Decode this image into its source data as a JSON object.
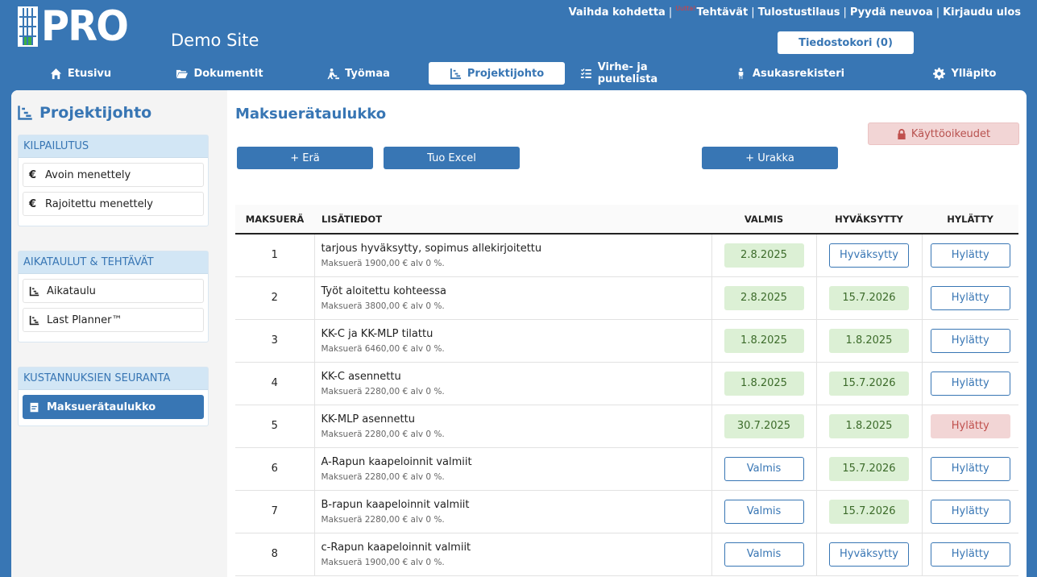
{
  "header": {
    "logo_text": "PRO",
    "site_title": "Demo Site",
    "top_links": [
      {
        "label": "Vaihda kohdetta"
      },
      {
        "label": "Tehtävät",
        "badge": "Uutta!"
      },
      {
        "label": "Tulostustilaus"
      },
      {
        "label": "Pyydä neuvoa"
      },
      {
        "label": "Kirjaudu ulos"
      }
    ],
    "cart_label": "Tiedostokori (0)"
  },
  "nav": {
    "items": [
      {
        "label": "Etusivu",
        "icon": "home-icon"
      },
      {
        "label": "Dokumentit",
        "icon": "folder-icon"
      },
      {
        "label": "Työmaa",
        "icon": "worker-icon"
      },
      {
        "label": "Projektijohto",
        "icon": "chart-icon",
        "active": true
      },
      {
        "label": "Virhe- ja puutelista",
        "icon": "checklist-icon"
      },
      {
        "label": "Asukasrekisteri",
        "icon": "person-icon"
      },
      {
        "label": "Ylläpito",
        "icon": "gear-icon"
      }
    ]
  },
  "sidebar": {
    "title": "Projektijohto",
    "sections": [
      {
        "title": "KILPAILUTUS",
        "items": [
          {
            "label": "Avoin menettely",
            "icon": "euro"
          },
          {
            "label": "Rajoitettu menettely",
            "icon": "euro"
          }
        ]
      },
      {
        "title": "AIKATAULUT & TEHTÄVÄT",
        "items": [
          {
            "label": "Aikataulu",
            "icon": "chart"
          },
          {
            "label": "Last Planner™",
            "icon": "chart"
          }
        ]
      },
      {
        "title": "KUSTANNUKSIEN SEURANTA",
        "items": [
          {
            "label": "Maksuerätaulukko",
            "icon": "doc",
            "active": true
          }
        ]
      }
    ]
  },
  "main": {
    "title": "Maksuerätaulukko",
    "permissions_label": "Käyttöoikeudet",
    "buttons": {
      "add_batch": "+ Erä",
      "import_excel": "Tuo Excel",
      "add_contract": "+ Urakka"
    },
    "table": {
      "headers": [
        "MAKSUERÄ",
        "LISÄTIEDOT",
        "VALMIS",
        "HYVÄKSYTTY",
        "HYLÄTTY"
      ],
      "rows": [
        {
          "num": "1",
          "desc": "tarjous hyväksytty, sopimus allekirjoitettu",
          "sub": "Maksuerä 1900,00 € alv 0 %.",
          "valmis": "2.8.2025",
          "valmis_state": "ok",
          "hyvaksytty": "Hyväksytty",
          "hyvaksytty_state": "outline",
          "hylatty": "Hylätty",
          "hylatty_state": "outline"
        },
        {
          "num": "2",
          "desc": "Työt aloitettu kohteessa",
          "sub": "Maksuerä 3800,00 € alv 0 %.",
          "valmis": "2.8.2025",
          "valmis_state": "ok",
          "hyvaksytty": "15.7.2026",
          "hyvaksytty_state": "ok",
          "hylatty": "Hylätty",
          "hylatty_state": "outline"
        },
        {
          "num": "3",
          "desc": "KK-C ja KK-MLP tilattu",
          "sub": "Maksuerä 6460,00 € alv 0 %.",
          "valmis": "1.8.2025",
          "valmis_state": "ok",
          "hyvaksytty": "1.8.2025",
          "hyvaksytty_state": "ok",
          "hylatty": "Hylätty",
          "hylatty_state": "outline"
        },
        {
          "num": "4",
          "desc": "KK-C asennettu",
          "sub": "Maksuerä 2280,00 € alv 0 %.",
          "valmis": "1.8.2025",
          "valmis_state": "ok",
          "hyvaksytty": "15.7.2026",
          "hyvaksytty_state": "ok",
          "hylatty": "Hylätty",
          "hylatty_state": "outline"
        },
        {
          "num": "5",
          "desc": "KK-MLP asennettu",
          "sub": "Maksuerä 2280,00 € alv 0 %.",
          "valmis": "30.7.2025",
          "valmis_state": "ok",
          "hyvaksytty": "1.8.2025",
          "hyvaksytty_state": "ok",
          "hylatty": "Hylätty",
          "hylatty_state": "rej"
        },
        {
          "num": "6",
          "desc": "A-Rapun kaapeloinnit valmiit",
          "sub": "Maksuerä 2280,00 € alv 0 %.",
          "valmis": "Valmis",
          "valmis_state": "outline",
          "hyvaksytty": "15.7.2026",
          "hyvaksytty_state": "ok",
          "hylatty": "Hylätty",
          "hylatty_state": "outline"
        },
        {
          "num": "7",
          "desc": "B-rapun kaapeloinnit valmiit",
          "sub": "Maksuerä 2280,00 € alv 0 %.",
          "valmis": "Valmis",
          "valmis_state": "outline",
          "hyvaksytty": "15.7.2026",
          "hyvaksytty_state": "ok",
          "hylatty": "Hylätty",
          "hylatty_state": "outline"
        },
        {
          "num": "8",
          "desc": "c-Rapun kaapeloinnit valmiit",
          "sub": "Maksuerä 1900,00 € alv 0 %.",
          "valmis": "Valmis",
          "valmis_state": "outline",
          "hyvaksytty": "Hyväksytty",
          "hyvaksytty_state": "outline",
          "hylatty": "Hylätty",
          "hylatty_state": "outline"
        }
      ]
    }
  }
}
